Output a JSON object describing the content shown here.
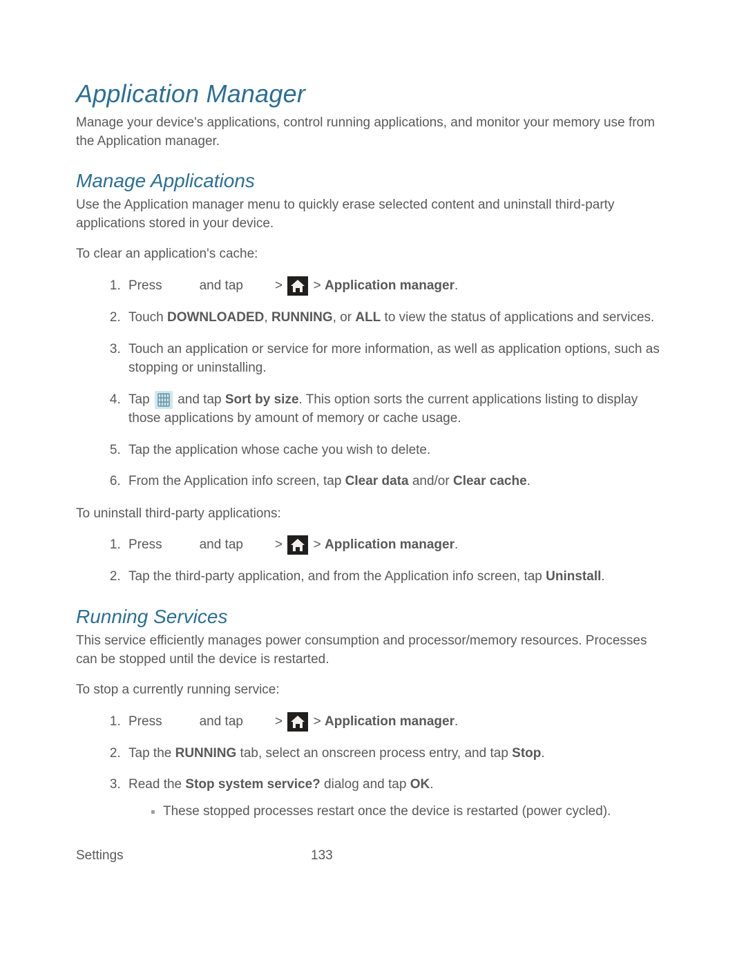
{
  "title": "Application Manager",
  "intro": "Manage your device's applications, control running applications, and monitor your memory use from the Application manager.",
  "section1": {
    "heading": "Manage Applications",
    "intro": "Use the Application manager menu to quickly erase selected content and uninstall third-party applications stored in your device.",
    "lead1": "To clear an application's cache:",
    "step1_a": "Press",
    "step1_b": "and tap",
    "gt": ">",
    "step1_end": "Application manager",
    "period": ".",
    "step2_a": "Touch ",
    "step2_b": "DOWNLOADED",
    "step2_c": ", ",
    "step2_d": "RUNNING",
    "step2_e": ", or ",
    "step2_f": "ALL",
    "step2_g": " to view the status of applications and services.",
    "step3": "Touch an application or service for more information, as well as application options, such as stopping or uninstalling.",
    "step4_a": "Tap ",
    "step4_b": " and tap ",
    "step4_c": "Sort by size",
    "step4_d": ". This option sorts the current applications listing to display those applications by amount of memory or cache usage.",
    "step5": "Tap the application whose cache you wish to delete.",
    "step6_a": "From the Application info screen, tap ",
    "step6_b": "Clear data",
    "step6_c": " and/or ",
    "step6_d": "Clear cache",
    "lead2": "To uninstall third-party applications:",
    "u2_a": "Tap the third-party application, and from the Application info screen, tap ",
    "u2_b": "Uninstall"
  },
  "section2": {
    "heading": "Running Services",
    "intro": "This service efficiently manages power consumption and processor/memory resources. Processes can be stopped until the device is restarted.",
    "lead": "To stop a currently running service:",
    "s2_a": "Tap the ",
    "s2_b": "RUNNING",
    "s2_c": " tab, select an onscreen process entry, and tap ",
    "s2_d": "Stop",
    "s3_a": "Read the ",
    "s3_b": "Stop system service?",
    "s3_c": " dialog and tap ",
    "s3_d": "OK",
    "bullet": "These stopped processes restart once the device is restarted (power cycled)."
  },
  "footer": {
    "section": "Settings",
    "page": "133"
  }
}
